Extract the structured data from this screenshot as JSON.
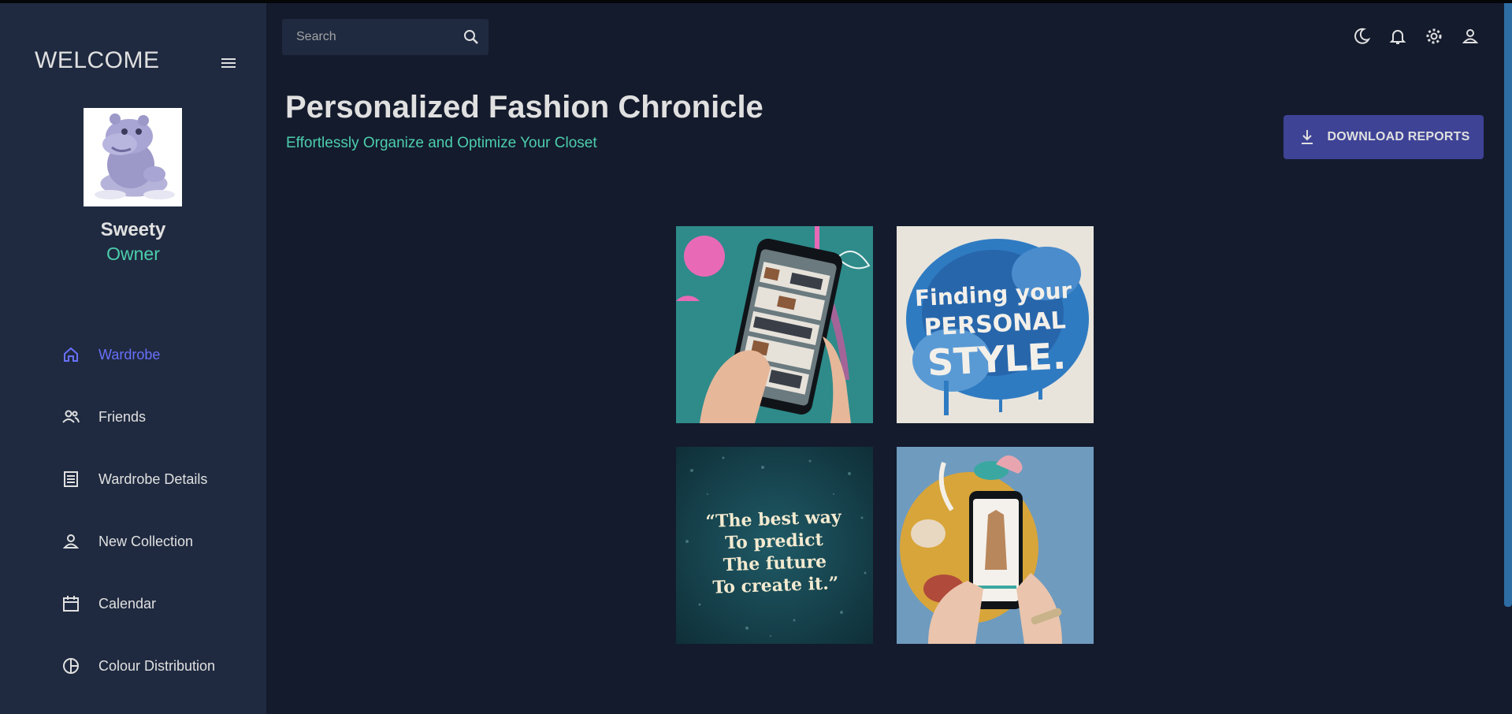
{
  "sidebar": {
    "welcome": "WELCOME",
    "user": {
      "name": "Sweety",
      "role": "Owner"
    },
    "items": [
      {
        "label": "Wardrobe",
        "icon": "home-icon",
        "active": true
      },
      {
        "label": "Friends",
        "icon": "people-icon",
        "active": false
      },
      {
        "label": "Wardrobe Details",
        "icon": "receipt-icon",
        "active": false
      },
      {
        "label": "New Collection",
        "icon": "person-icon",
        "active": false
      },
      {
        "label": "Calendar",
        "icon": "calendar-icon",
        "active": false
      },
      {
        "label": "Colour Distribution",
        "icon": "pie-chart-icon",
        "active": false
      }
    ]
  },
  "topbar": {
    "search_placeholder": "Search",
    "icons": [
      "dark-mode-icon",
      "notifications-icon",
      "settings-icon",
      "profile-icon"
    ]
  },
  "header": {
    "title": "Personalized Fashion Chronicle",
    "subtitle": "Effortlessly Organize and Optimize Your Closet",
    "download_label": "DOWNLOAD REPORTS"
  },
  "gallery": {
    "tile2": {
      "line1": "Finding your",
      "line2": "PERSONAL",
      "line3": "STYLE."
    },
    "tile3": {
      "line1": "“The best way",
      "line2": "To predict",
      "line3": "The future",
      "line4": "To create it.”"
    }
  },
  "colors": {
    "background": "#141b2d",
    "sidebar": "#1f2a40",
    "accent_green": "#4cceac",
    "accent_blue": "#6870fa",
    "button": "#3e4396"
  }
}
